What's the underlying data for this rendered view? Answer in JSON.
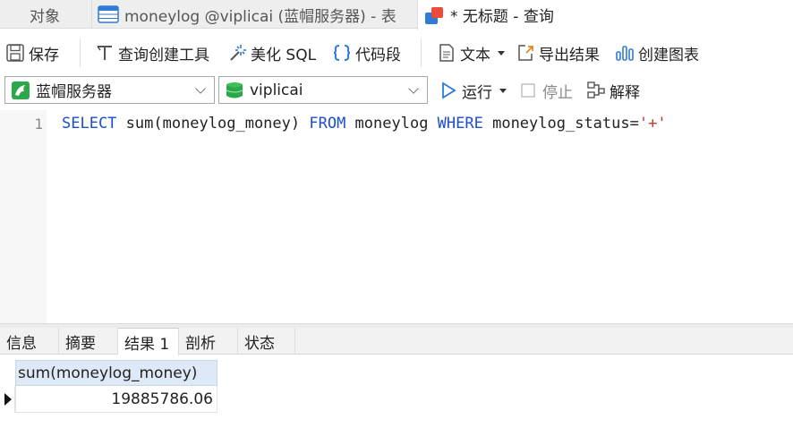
{
  "tabs": [
    {
      "label": "对象"
    },
    {
      "label": "moneylog @viplicai (蓝帽服务器) - 表"
    },
    {
      "label": "* 无标题 - 查询"
    }
  ],
  "toolbar": {
    "save": "保存",
    "query_builder": "查询创建工具",
    "beautify_sql": "美化 SQL",
    "code_snippet": "代码段",
    "text": "文本",
    "export_result": "导出结果",
    "create_chart": "创建图表"
  },
  "connection": {
    "server": "蓝帽服务器",
    "database": "viplicai",
    "run": "运行",
    "stop": "停止",
    "explain": "解释"
  },
  "editor": {
    "line_number": "1",
    "tokens": {
      "select": "SELECT",
      "expr": " sum(moneylog_money) ",
      "from": "FROM",
      "table": " moneylog ",
      "where": "WHERE",
      "cond": " moneylog_status=",
      "value": "'+'"
    }
  },
  "result_tabs": [
    "信息",
    "摘要",
    "结果 1",
    "剖析",
    "状态"
  ],
  "grid": {
    "column": "sum(moneylog_money)",
    "value": "19885786.06"
  },
  "colors": {
    "keyword": "#1a4fd0",
    "string": "#c0392b",
    "accent_blue": "#2f7bd6",
    "db_green": "#2aa84a"
  }
}
